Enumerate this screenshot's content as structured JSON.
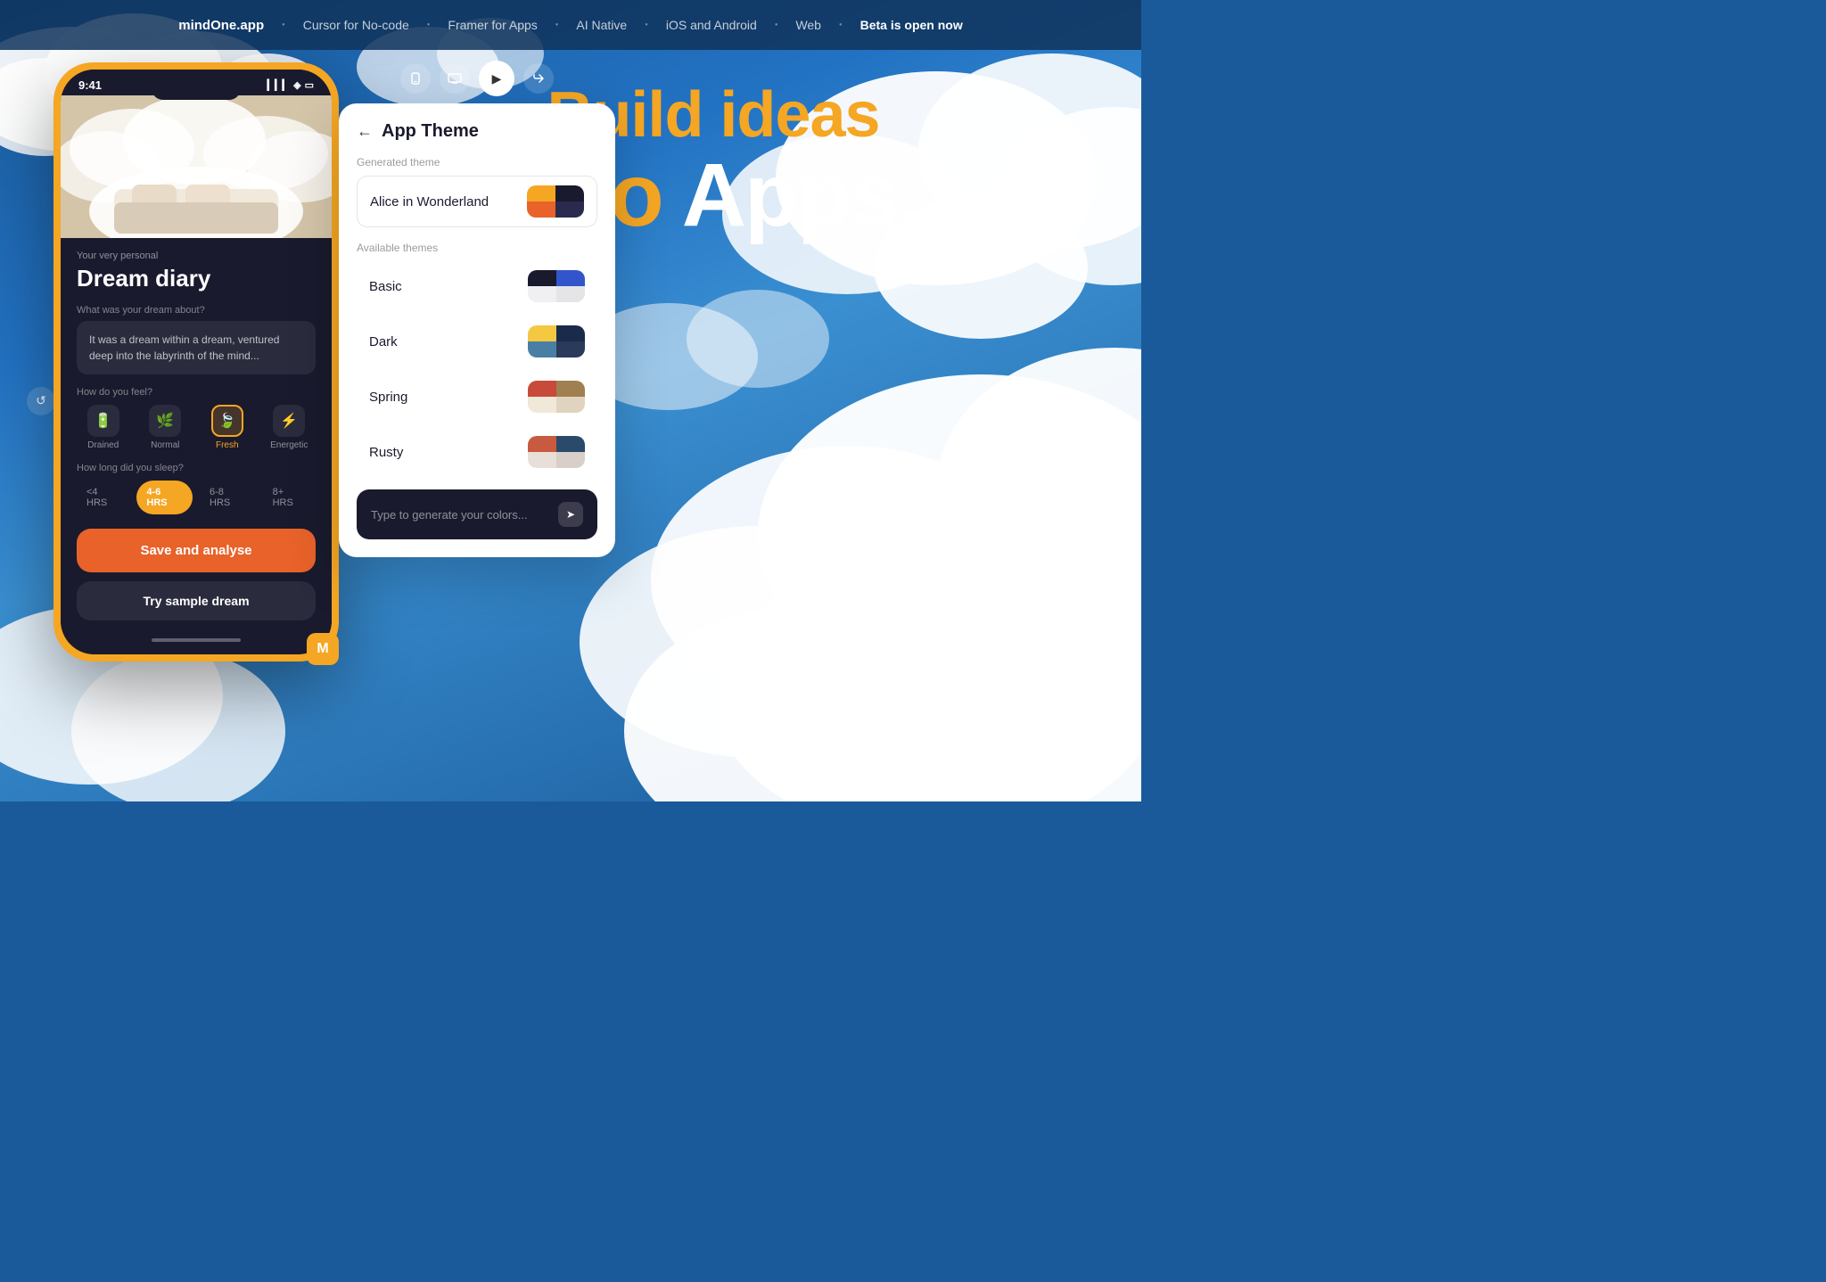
{
  "navbar": {
    "brand": "mindOne.app",
    "items": [
      {
        "label": "Cursor for No-code"
      },
      {
        "label": "Framer for Apps"
      },
      {
        "label": "AI Native"
      },
      {
        "label": "iOS and Android"
      },
      {
        "label": "Web"
      },
      {
        "label": "Beta is open now",
        "highlight": true
      }
    ]
  },
  "hero": {
    "line1": "Build ideas",
    "line2_part1": "into",
    "line2_part2": "Apps."
  },
  "phone": {
    "time": "9:41",
    "subtitle": "Your very personal",
    "title": "Dream diary",
    "dream_label": "What was your dream about?",
    "dream_text": "It was a dream within a dream, ventured deep into the labyrinth of the mind...",
    "feel_label": "How do you feel?",
    "feel_options": [
      {
        "label": "Drained",
        "icon": "🔋",
        "active": false
      },
      {
        "label": "Normal",
        "icon": "🌿",
        "active": false
      },
      {
        "label": "Fresh",
        "icon": "🍃",
        "active": true
      },
      {
        "label": "Energetic",
        "icon": "⚡",
        "active": false
      }
    ],
    "sleep_label": "How long did you sleep?",
    "sleep_options": [
      {
        "label": "<4 HRS",
        "active": false
      },
      {
        "label": "4-6 HRS",
        "active": true
      },
      {
        "label": "6-8 HRS",
        "active": false
      },
      {
        "label": "8+ HRS",
        "active": false
      }
    ],
    "save_btn": "Save and analyse",
    "sample_btn": "Try sample dream"
  },
  "theme_panel": {
    "title": "App Theme",
    "generated_label": "Generated theme",
    "generated_name": "Alice in Wonderland",
    "available_label": "Available themes",
    "themes": [
      {
        "name": "Basic",
        "swatch_class": "basic-swatch"
      },
      {
        "name": "Dark",
        "swatch_class": "dark-swatch"
      },
      {
        "name": "Spring",
        "swatch_class": "spring-swatch"
      },
      {
        "name": "Rusty",
        "swatch_class": "rusty-swatch"
      }
    ],
    "generate_placeholder": "Type to generate your colors...",
    "generate_send_icon": "➤"
  }
}
